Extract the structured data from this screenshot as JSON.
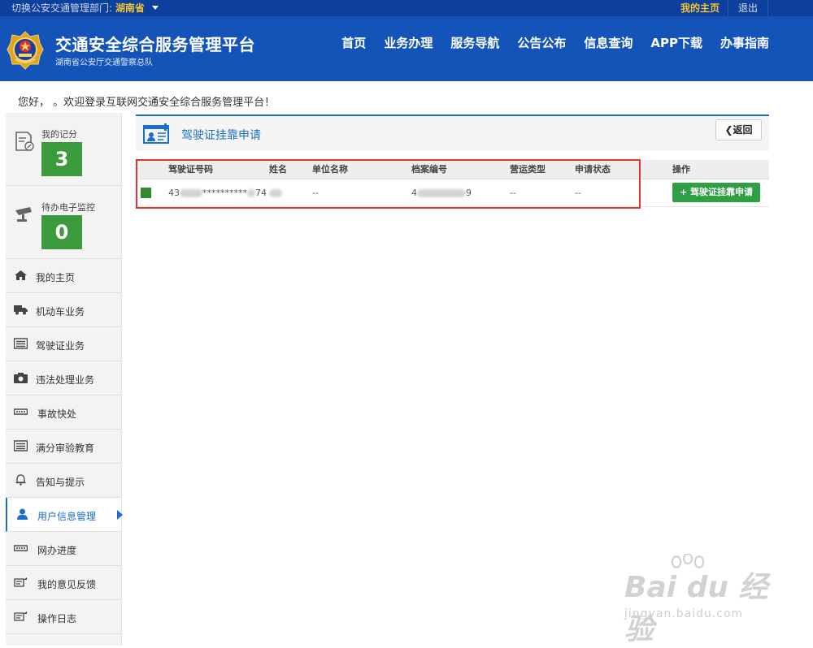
{
  "topbar": {
    "dept_label": "切换公安交通管理部门:",
    "dept_value": "湖南省",
    "home_label": "我的主页",
    "logout_label": "退出"
  },
  "header": {
    "title": "交通安全综合服务管理平台",
    "subtitle": "湖南省公安厅交通警察总队",
    "nav": [
      "首页",
      "业务办理",
      "服务导航",
      "公告公布",
      "信息查询",
      "APP下载",
      "办事指南"
    ]
  },
  "welcome": "您好，  。欢迎登录互联网交通安全综合服务管理平台！",
  "sidebar": {
    "stats": [
      {
        "label": "我的记分",
        "value": "3"
      },
      {
        "label": "待办电子监控",
        "value": "0"
      }
    ],
    "items": [
      {
        "label": "我的主页",
        "icon": "home-icon"
      },
      {
        "label": "机动车业务",
        "icon": "truck-icon"
      },
      {
        "label": "驾驶证业务",
        "icon": "license-icon"
      },
      {
        "label": "违法处理业务",
        "icon": "camera-icon"
      },
      {
        "label": "事故快处",
        "icon": "accident-icon"
      },
      {
        "label": "满分审验教育",
        "icon": "list-icon"
      },
      {
        "label": "告知与提示",
        "icon": "bell-icon"
      },
      {
        "label": "用户信息管理",
        "icon": "user-icon"
      },
      {
        "label": "网办进度",
        "icon": "progress-icon"
      },
      {
        "label": "我的意见反馈",
        "icon": "feedback-icon"
      },
      {
        "label": "操作日志",
        "icon": "log-icon"
      }
    ],
    "active_index": 7
  },
  "panel": {
    "title": "驾驶证挂靠申请",
    "back_label": "返回"
  },
  "table": {
    "headers": [
      "驾驶证号码",
      "姓名",
      "单位名称",
      "档案编号",
      "营运类型",
      "申请状态",
      "操作"
    ],
    "rows": [
      {
        "license_no_head": "43",
        "license_no_mid": "**********",
        "license_no_tail": "74",
        "name": "",
        "unit": "--",
        "file_no_head": "4",
        "file_no_tail": "9",
        "op_type": "--",
        "status": "--",
        "action": "驾驶证挂靠申请"
      }
    ]
  },
  "watermark": {
    "brand": "Bai du 经验",
    "url": "jingyan.baidu.com"
  },
  "colors": {
    "topbar": "#0d3f9c",
    "header": "#1454b8",
    "accent": "#1c6ec8",
    "green": "#3a9a3c",
    "highlight_box": "#e53333"
  }
}
